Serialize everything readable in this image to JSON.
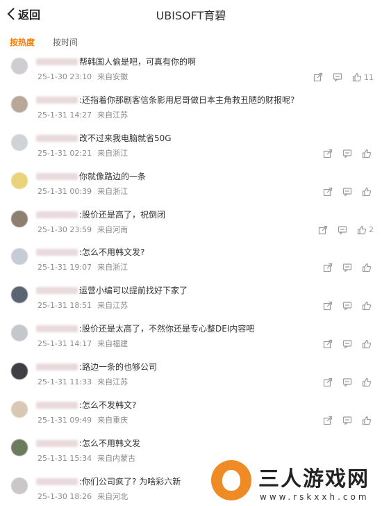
{
  "header": {
    "back_label": "返回",
    "title": "UBISOFT育碧"
  },
  "sort_tabs": [
    {
      "label": "按热度",
      "active": true
    },
    {
      "label": "按时间",
      "active": false
    }
  ],
  "comments": [
    {
      "text": "帮韩国人偷是吧，可真有你的啊",
      "time": "25-1-30 23:10",
      "location": "来自安徽",
      "likes": "11",
      "show_actions": true,
      "avatar_color": "#d0cdd2"
    },
    {
      "text": ":还指着你那剧客信条影用尼哥做日本主角救丑陋的财报呢?",
      "time": "25-1-31 14:27",
      "location": "来自江苏",
      "likes": "",
      "show_actions": false,
      "avatar_color": "#b8a89a"
    },
    {
      "text": "改不过来我电脑就省50G",
      "time": "25-1-31 02:21",
      "location": "来自浙江",
      "likes": "",
      "show_actions": true,
      "avatar_color": "#cfd3d8"
    },
    {
      "text": "你就像路边的一条",
      "time": "25-1-31 00:39",
      "location": "来自浙江",
      "likes": "",
      "show_actions": true,
      "avatar_color": "#e8d37a"
    },
    {
      "text": ":股价还是高了，祝倒闭",
      "time": "25-1-30 23:59",
      "location": "来自河南",
      "likes": "2",
      "show_actions": true,
      "avatar_color": "#8d7f72"
    },
    {
      "text": ":怎么不用韩文发?",
      "time": "25-1-31 19:07",
      "location": "来自浙江",
      "likes": "",
      "show_actions": true,
      "avatar_color": "#c6ccd6"
    },
    {
      "text": "运营小编可以提前找好下家了",
      "time": "25-1-31 18:51",
      "location": "来自江苏",
      "likes": "",
      "show_actions": true,
      "avatar_color": "#5a6473"
    },
    {
      "text": ":股价还是太高了，不然你还是专心整DEI内容吧",
      "time": "25-1-31 14:17",
      "location": "来自福建",
      "likes": "",
      "show_actions": true,
      "avatar_color": "#c4c8cc"
    },
    {
      "text": ":路边一条的也够公司",
      "time": "25-1-31 11:33",
      "location": "来自江苏",
      "likes": "",
      "show_actions": true,
      "avatar_color": "#3e4046"
    },
    {
      "text": ":怎么不发韩文?",
      "time": "25-1-31 09:49",
      "location": "来自重庆",
      "likes": "",
      "show_actions": true,
      "avatar_color": "#d9c9b4"
    },
    {
      "text": ":怎么不用韩文发",
      "time": "25-1-31 15:34",
      "location": "来自内蒙古",
      "likes": "",
      "show_actions": false,
      "avatar_color": "#6c7a5e"
    },
    {
      "text": ":你们公司疯了? 为啥彩六新",
      "time": "25-1-30 18:26",
      "location": "来自河北",
      "likes": "",
      "show_actions": false,
      "avatar_color": "#cbc7c9"
    }
  ],
  "watermark": {
    "title": "三人游戏网",
    "url": "www.rskxxh.com"
  },
  "colors": {
    "accent": "#ff7d00",
    "icon": "#9a9a9a"
  }
}
